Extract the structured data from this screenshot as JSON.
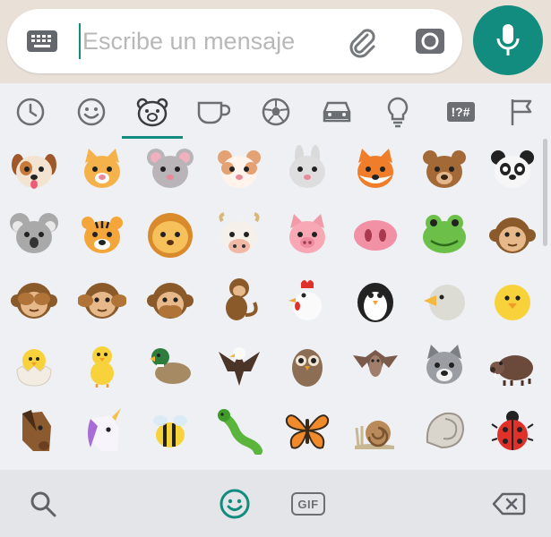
{
  "compose": {
    "placeholder": "Escribe un mensaje"
  },
  "categories": [
    {
      "name": "recent",
      "icon": "clock-icon"
    },
    {
      "name": "smileys",
      "icon": "smiley-icon"
    },
    {
      "name": "animals",
      "icon": "bear-face-icon",
      "selected": true
    },
    {
      "name": "food",
      "icon": "cup-icon"
    },
    {
      "name": "activities",
      "icon": "soccer-ball-icon"
    },
    {
      "name": "travel",
      "icon": "car-icon"
    },
    {
      "name": "objects",
      "icon": "lightbulb-icon"
    },
    {
      "name": "symbols",
      "icon": "symbols-icon",
      "label": "!?#"
    },
    {
      "name": "flags",
      "icon": "flag-icon"
    }
  ],
  "emoji_rows": [
    [
      "dog-face",
      "cat-face",
      "mouse-face",
      "hamster-face",
      "rabbit-face",
      "fox-face",
      "bear-face",
      "panda-face"
    ],
    [
      "koala",
      "tiger-face",
      "lion-face",
      "cow-face",
      "pig-face",
      "pig-nose",
      "frog-face",
      "monkey-face"
    ],
    [
      "see-no-evil-monkey",
      "hear-no-evil-monkey",
      "speak-no-evil-monkey",
      "monkey",
      "chicken",
      "penguin",
      "bird",
      "baby-chick"
    ],
    [
      "hatching-chick",
      "front-facing-baby-chick",
      "duck",
      "eagle",
      "owl",
      "bat",
      "wolf",
      "boar"
    ],
    [
      "horse-face",
      "unicorn",
      "honeybee",
      "bug",
      "butterfly",
      "snail",
      "spiral-shell",
      "lady-beetle"
    ]
  ],
  "bottom_bar": {
    "gif_label": "GIF"
  },
  "colors": {
    "accent": "#128c7e",
    "icon_gray": "#6b6f73"
  }
}
